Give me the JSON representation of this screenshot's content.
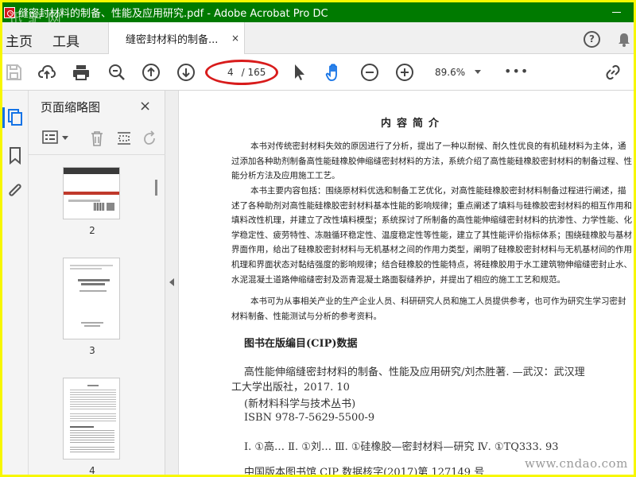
{
  "window": {
    "title": "缝密封材料的制备、性能及应用研究.pdf - Adobe Acrobat Pro DC",
    "watermark": "迅 驴 网"
  },
  "tabs": {
    "home": "主页",
    "tools": "工具",
    "document_tab": "缝密封材料的制备...",
    "close_symbol": "×"
  },
  "toolbar": {
    "page_current": "4",
    "page_total": "/ 165",
    "zoom": "89.6%",
    "more": "•••",
    "accent_color": "#1473e6",
    "highlight_color": "#d81b1b"
  },
  "thumbnail_panel": {
    "title": "页面缩略图",
    "close_symbol": "×",
    "pages": [
      {
        "number": "2"
      },
      {
        "number": "3"
      },
      {
        "number": "4"
      }
    ]
  },
  "document": {
    "heading": "内容简介",
    "paragraphs": [
      "本书对传统密封材料失效的原因进行了分析，提出了一种以耐候、耐久性优良的有机硅材料为主体，通过添加各种助剂制备高性能硅橡胶伸缩缝密封材料的方法，系统介绍了高性能硅橡胶密封材料的制备过程、性能分析方法及应用施工工艺。",
      "本书主要内容包括：围绕原材料优选和制备工艺优化，对高性能硅橡胶密封材料制备过程进行阐述，描述了各种助剂对高性能硅橡胶密封材料基本性能的影响规律；重点阐述了填料与硅橡胶密封材料的相互作用和填料改性机理，并建立了改性填料模型；系统探讨了所制备的高性能伸缩缝密封材料的抗渗性、力学性能、化学稳定性、疲劳特性、冻融循环稳定性、温度稳定性等性能，建立了其性能评价指标体系；围绕硅橡胶与基材界面作用，给出了硅橡胶密封材料与无机基材之间的作用力类型，阐明了硅橡胶密封材料与无机基材间的作用机理和界面状态对黏结强度的影响规律；结合硅橡胶的性能特点，将硅橡胶用于水工建筑物伸缩缝密封止水、水泥混凝土道路伸缩缝密封及沥青混凝土路面裂缝养护，并提出了相应的施工工艺和规范。",
      "本书可为从事相关产业的生产企业人员、科研研究人员和施工人员提供参考，也可作为研究生学习密封材料制备、性能测试与分析的参考资料。"
    ],
    "cip_title": "图书在版编目(CIP)数据",
    "cip_lines": [
      "高性能伸缩缝密封材料的制备、性能及应用研究/刘杰胜著. —武汉：武汉理",
      "工大学出版社，2017. 10",
      "(新材料科学与技术丛书)",
      "ISBN 978-7-5629-5500-9",
      "Ⅰ. ①高…   Ⅱ. ①刘…   Ⅲ. ①硅橡胶—密封材料—研究   Ⅳ. ①TQ333. 93",
      "中国版本图书馆 CIP 数据核字(2017)第 127149 号"
    ],
    "watermark": "www.cndao.com"
  }
}
